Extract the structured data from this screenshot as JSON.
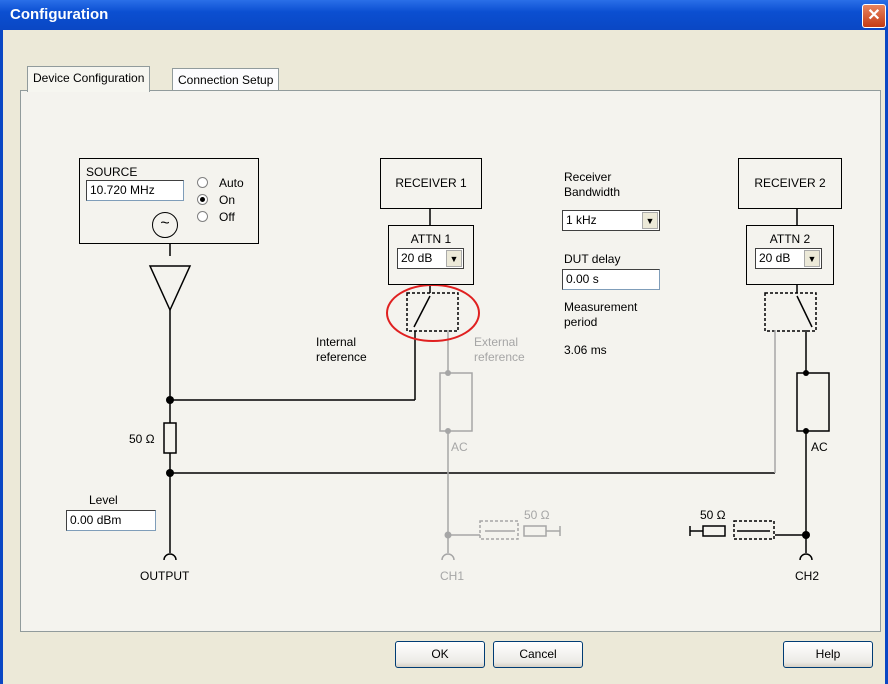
{
  "window": {
    "title": "Configuration",
    "close_icon": "close-icon"
  },
  "tabs": [
    {
      "label": "Device Configuration",
      "active": true
    },
    {
      "label": "Connection Setup",
      "active": false
    }
  ],
  "source": {
    "title": "SOURCE",
    "frequency": "10.720 MHz",
    "options": [
      "Auto",
      "On",
      "Off"
    ],
    "selected": "On"
  },
  "receiver1": {
    "title": "RECEIVER 1",
    "attn_label": "ATTN 1",
    "attn_value": "20 dB"
  },
  "receiver2": {
    "title": "RECEIVER 2",
    "attn_label": "ATTN 2",
    "attn_value": "20 dB"
  },
  "settings": {
    "bandwidth_label_1": "Receiver",
    "bandwidth_label_2": "Bandwidth",
    "bandwidth_value": "1 kHz",
    "dut_delay_label": "DUT delay",
    "dut_delay_value": "0.00 s",
    "measurement_label_1": "Measurement",
    "measurement_label_2": "period",
    "measurement_value": "3.06 ms"
  },
  "diagram": {
    "internal_ref_1": "Internal",
    "internal_ref_2": "reference",
    "external_ref_1": "External",
    "external_ref_2": "reference",
    "resistor_output": "50 Ω",
    "resistor_ch1": "50 Ω",
    "resistor_ch2": "50 Ω",
    "ac_ch1": "AC",
    "ac_ch2": "AC",
    "output_label": "OUTPUT",
    "ch1_label": "CH1",
    "ch2_label": "CH2",
    "level_label": "Level",
    "level_value": "0.00 dBm"
  },
  "buttons": {
    "ok": "OK",
    "cancel": "Cancel",
    "help": "Help"
  },
  "colors": {
    "title_bar": "#0a47c4",
    "highlight_ellipse": "#e02020",
    "disabled": "#a6a6a6"
  }
}
